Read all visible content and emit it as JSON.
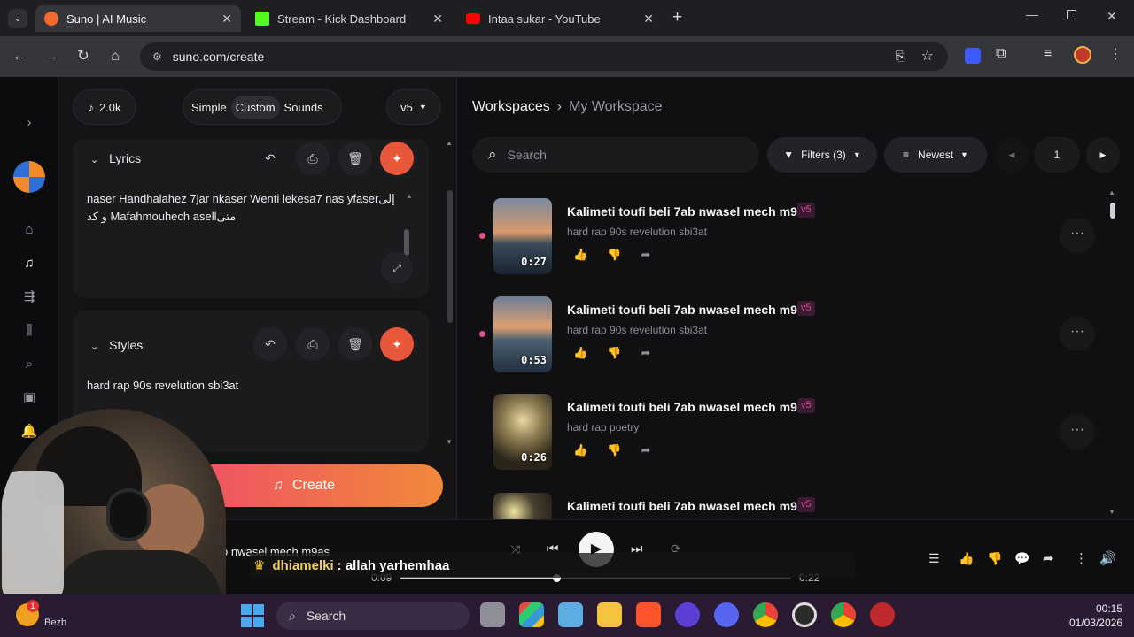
{
  "browser": {
    "tabs": [
      {
        "title": "Suno | AI Music",
        "active": true,
        "favicon_color": "#f06a2b"
      },
      {
        "title": "Stream - Kick Dashboard",
        "active": false,
        "favicon_color": "#53fc18"
      },
      {
        "title": "Intaa sukar - YouTube",
        "active": false,
        "favicon_color": "#ff0000"
      }
    ],
    "url": "suno.com/create"
  },
  "left_panel": {
    "credits": "2.0k",
    "modes": [
      "Simple",
      "Custom",
      "Sounds"
    ],
    "active_mode": "Custom",
    "version": "v5",
    "lyrics": {
      "label": "Lyrics",
      "line1": "naser Handhalahez 7jar nkaser Wenti lekesa7 nas yfaserإلى",
      "line2": "و كذ Mafahmouhech asellمتى"
    },
    "styles": {
      "label": "Styles",
      "value": "hard rap 90s revelution sbi3at"
    },
    "create_label": "Create"
  },
  "workspace": {
    "breadcrumb_root": "Workspaces",
    "breadcrumb_current": "My Workspace",
    "search_placeholder": "Search",
    "filters_label": "Filters (3)",
    "sort_label": "Newest",
    "page": "1"
  },
  "songs": [
    {
      "title": "Kalimeti toufi beli 7ab nwasel mech m9as",
      "badge": "v5",
      "style": "hard rap 90s revelution sbi3at",
      "duration": "0:27",
      "dot": true
    },
    {
      "title": "Kalimeti toufi beli 7ab nwasel mech m9as",
      "badge": "v5",
      "style": "hard rap 90s revelution sbi3at",
      "duration": "0:53",
      "dot": true
    },
    {
      "title": "Kalimeti toufi beli 7ab nwasel mech m9as",
      "badge": "v5",
      "style": "hard rap poetry",
      "duration": "0:26",
      "dot": false
    },
    {
      "title": "Kalimeti toufi beli 7ab nwasel mech m9as",
      "badge": "v5",
      "style": "",
      "duration": "",
      "dot": false
    }
  ],
  "player": {
    "now_playing": "o nwasel mech m9as",
    "elapsed": "0:09",
    "total": "0:22",
    "progress": 0.4
  },
  "chat_overlay": {
    "user": "dhiamelki",
    "message": ": allah yarhemhaa"
  },
  "taskbar": {
    "search_label": "Search",
    "time": "00:15",
    "date": "01/03/2026",
    "weather_label": "Bezh",
    "weather_badge": "1"
  },
  "colors": {
    "accent": "#e8573a",
    "brand_pink": "#d9489a",
    "create_gradient_start": "#f04a6a",
    "create_gradient_end": "#f08a3a"
  }
}
